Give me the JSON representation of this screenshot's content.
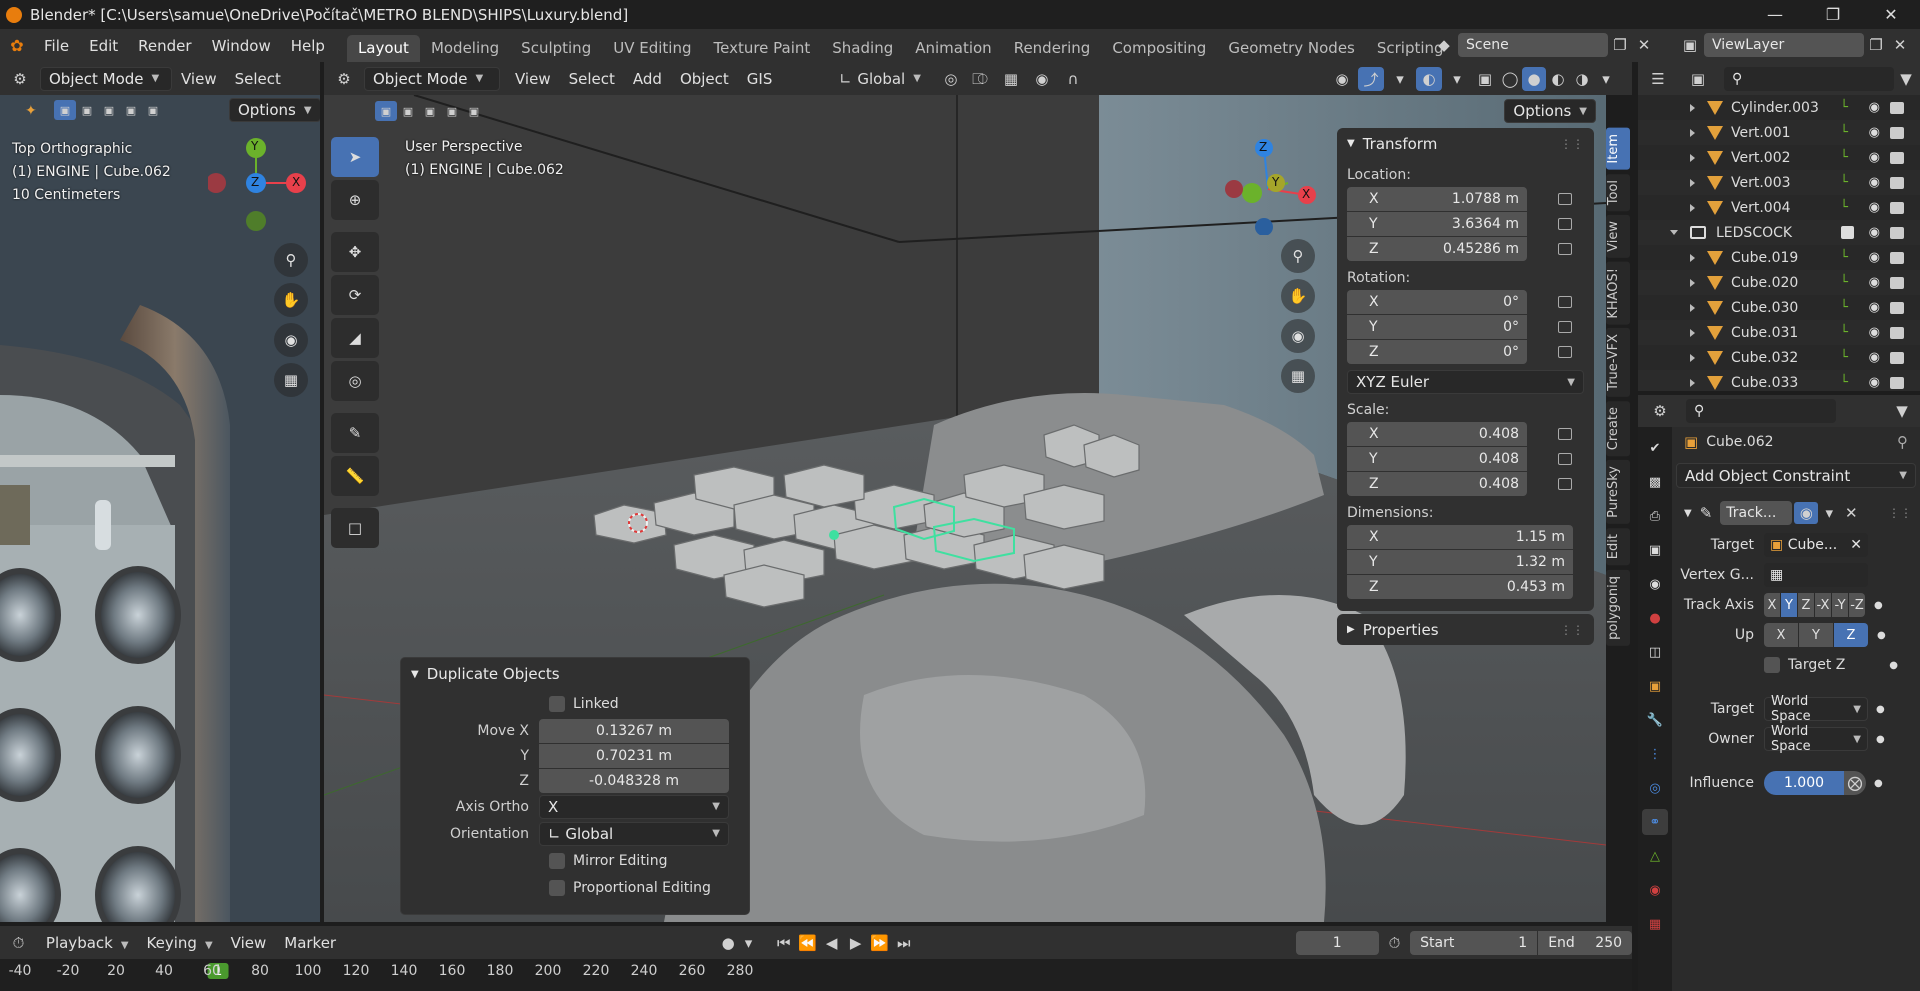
{
  "titlebar": {
    "title": "Blender* [C:\\Users\\samue\\OneDrive\\Počítač\\METRO BLEND\\SHIPS\\Luxury.blend]"
  },
  "menu": {
    "items": [
      "File",
      "Edit",
      "Render",
      "Window",
      "Help"
    ]
  },
  "workspaces": [
    "Layout",
    "Modeling",
    "Sculpting",
    "UV Editing",
    "Texture Paint",
    "Shading",
    "Animation",
    "Rendering",
    "Compositing",
    "Geometry Nodes",
    "Scripting"
  ],
  "scene": {
    "name": "Scene",
    "view_layer": "ViewLayer"
  },
  "left_viewport": {
    "mode": "Object Mode",
    "menus": [
      "View",
      "Select"
    ],
    "options": "Options",
    "view_name": "Top Orthographic",
    "object_info": "(1) ENGINE | Cube.062",
    "scale_info": "10 Centimeters",
    "gizmo": {
      "y": "Y",
      "z": "Z",
      "x": "X"
    }
  },
  "main_viewport": {
    "mode": "Object Mode",
    "menus": [
      "View",
      "Select",
      "Add",
      "Object",
      "GIS"
    ],
    "orientation": "Global",
    "options": "Options",
    "view_name": "User Perspective",
    "object_info": "(1) ENGINE | Cube.062",
    "gizmo": {
      "z": "Z",
      "y": "Y",
      "x": "X"
    }
  },
  "transform_panel": {
    "title": "Transform",
    "location_label": "Location:",
    "location": [
      {
        "axis": "X",
        "value": "1.0788 m"
      },
      {
        "axis": "Y",
        "value": "3.6364 m"
      },
      {
        "axis": "Z",
        "value": "0.45286 m"
      }
    ],
    "rotation_label": "Rotation:",
    "rotation": [
      {
        "axis": "X",
        "value": "0°"
      },
      {
        "axis": "Y",
        "value": "0°"
      },
      {
        "axis": "Z",
        "value": "0°"
      }
    ],
    "rotation_mode": "XYZ Euler",
    "scale_label": "Scale:",
    "scale": [
      {
        "axis": "X",
        "value": "0.408"
      },
      {
        "axis": "Y",
        "value": "0.408"
      },
      {
        "axis": "Z",
        "value": "0.408"
      }
    ],
    "dimensions_label": "Dimensions:",
    "dimensions": [
      {
        "axis": "X",
        "value": "1.15 m"
      },
      {
        "axis": "Y",
        "value": "1.32 m"
      },
      {
        "axis": "Z",
        "value": "0.453 m"
      }
    ],
    "properties_title": "Properties"
  },
  "side_tabs": [
    "Item",
    "Tool",
    "View",
    "KHAOS!",
    "True-VFX",
    "Create",
    "PureSky",
    "Edit",
    "polygoniq"
  ],
  "redo_panel": {
    "title": "Duplicate Objects",
    "linked": "Linked",
    "move_x_label": "Move X",
    "move_x": "0.13267 m",
    "y_label": "Y",
    "move_y": "0.70231 m",
    "z_label": "Z",
    "move_z": "-0.048328 m",
    "axis_ortho_label": "Axis Ortho",
    "axis_ortho": "X",
    "orientation_label": "Orientation",
    "orientation": "Global",
    "mirror_editing": "Mirror Editing",
    "proportional_editing": "Proportional Editing"
  },
  "outliner": {
    "rows": [
      {
        "name": "Cylinder.003",
        "indent": 2,
        "type": "mesh"
      },
      {
        "name": "Vert.001",
        "indent": 2,
        "type": "mesh"
      },
      {
        "name": "Vert.002",
        "indent": 2,
        "type": "mesh"
      },
      {
        "name": "Vert.003",
        "indent": 2,
        "type": "mesh"
      },
      {
        "name": "Vert.004",
        "indent": 2,
        "type": "mesh"
      },
      {
        "name": "LEDSCOCK",
        "indent": 1,
        "type": "collection"
      },
      {
        "name": "Cube.019",
        "indent": 2,
        "type": "mesh"
      },
      {
        "name": "Cube.020",
        "indent": 2,
        "type": "mesh"
      },
      {
        "name": "Cube.030",
        "indent": 2,
        "type": "mesh"
      },
      {
        "name": "Cube.031",
        "indent": 2,
        "type": "mesh"
      },
      {
        "name": "Cube.032",
        "indent": 2,
        "type": "mesh"
      },
      {
        "name": "Cube.033",
        "indent": 2,
        "type": "mesh"
      }
    ]
  },
  "properties": {
    "object_name": "Cube.062",
    "add_constraint": "Add Object Constraint",
    "constraint_name": "Track...",
    "target_label": "Target",
    "target_value": "Cube...",
    "vertex_group_label": "Vertex G...",
    "track_axis_label": "Track Axis",
    "track_axis_options": [
      "X",
      "Y",
      "Z",
      "-X",
      "-Y",
      "-Z"
    ],
    "up_label": "Up",
    "up_options": [
      "X",
      "Y",
      "Z"
    ],
    "target_z": "Target Z",
    "target_space_label": "Target",
    "target_space": "World Space",
    "owner_space_label": "Owner",
    "owner_space": "World Space",
    "influence_label": "Influence",
    "influence": "1.000"
  },
  "timeline": {
    "menus": [
      "Playback",
      "Keying",
      "View",
      "Marker"
    ],
    "current_frame": "1",
    "start_label": "Start",
    "start": "1",
    "end_label": "End",
    "end": "250",
    "ruler_marks": [
      "-40",
      "-20",
      "1",
      "20",
      "40",
      "60",
      "80",
      "100",
      "120",
      "140",
      "160",
      "180",
      "200",
      "220",
      "240",
      "260",
      "280"
    ]
  },
  "colors": {
    "accent": "#4772b3",
    "selection_outline": "#3fe0a0",
    "x_axis": "#e8404b",
    "y_axis": "#6bb22b",
    "z_axis": "#2f83e0",
    "mesh_icon": "#e3a13b"
  }
}
